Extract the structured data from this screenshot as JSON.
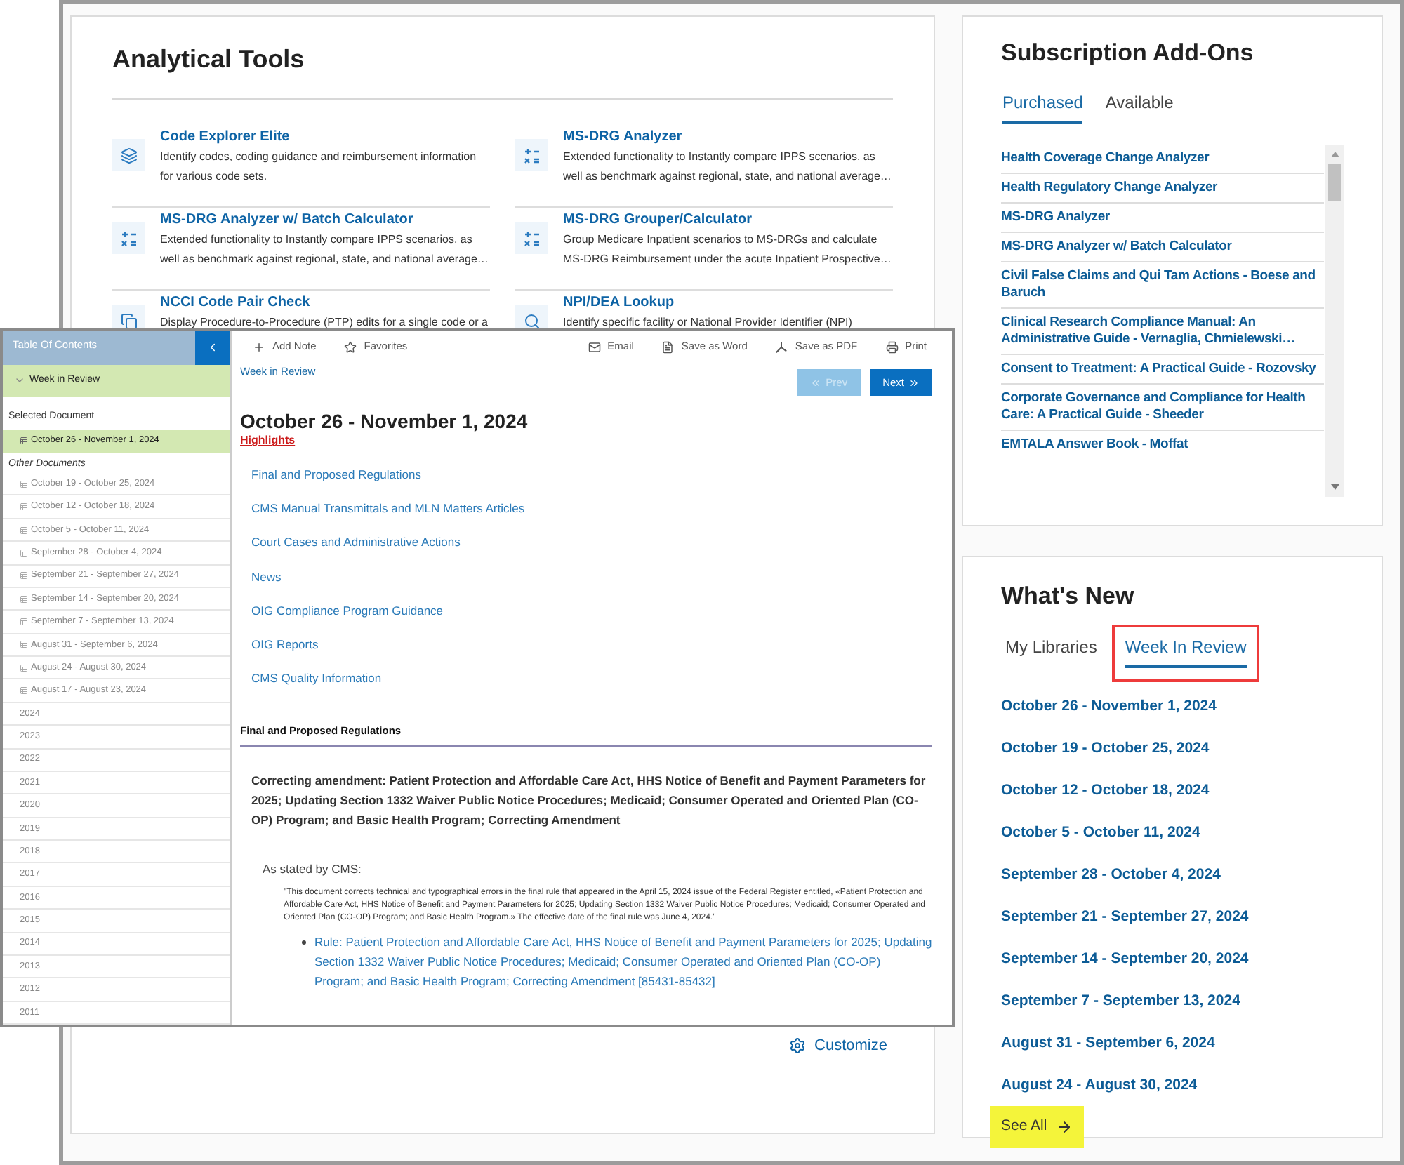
{
  "analytical_tools": {
    "title": "Analytical Tools",
    "tools": [
      {
        "kind": "explorer",
        "name": "Code Explorer Elite",
        "description": "Identify codes, coding guidance and reimbursement information for various code sets."
      },
      {
        "kind": "analyzer",
        "name": "MS-DRG Analyzer",
        "description": "Extended functionality to Instantly compare IPPS scenarios, as well as benchmark against regional, state, and national average…"
      },
      {
        "kind": "analyzer",
        "name": "MS-DRG Analyzer w/ Batch Calculator",
        "description": "Extended functionality to Instantly compare IPPS scenarios, as well as benchmark against regional, state, and national average…"
      },
      {
        "kind": "analyzer",
        "name": "MS-DRG Grouper/Calculator",
        "description": "Group Medicare Inpatient scenarios to MS-DRGs and calculate MS-DRG Reimbursement under the acute Inpatient Prospective…"
      },
      {
        "kind": "pair_check",
        "name": "NCCI Code Pair Check",
        "description": "Display Procedure-to-Procedure (PTP) edits for a single code or a"
      },
      {
        "kind": "lookup",
        "name": "NPI/DEA Lookup",
        "description": "Identify specific facility or National Provider Identifier (NPI)"
      }
    ],
    "customize": "Customize"
  },
  "subscription_addons": {
    "title": "Subscription Add-Ons",
    "tabs": [
      {
        "label": "Purchased",
        "selected": true
      },
      {
        "label": "Available",
        "selected": false
      }
    ],
    "items": [
      "Health Coverage Change Analyzer",
      "Health Regulatory Change Analyzer",
      "MS-DRG Analyzer",
      "MS-DRG Analyzer w/ Batch Calculator",
      "Civil False Claims and Qui Tam Actions - Boese and Baruch",
      "Clinical Research Compliance Manual: An Administrative Guide - Vernaglia, Chmielewski…",
      "Consent to Treatment: A Practical Guide - Rozovsky",
      "Corporate Governance and Compliance for Health Care: A Practical Guide - Sheeder",
      "EMTALA Answer Book - Moffat"
    ]
  },
  "whats_new": {
    "title": "What's New",
    "tabs": [
      {
        "label": "My Libraries",
        "selected": false,
        "annotated": false
      },
      {
        "label": "Week In Review",
        "selected": true,
        "annotated": true
      }
    ],
    "items": [
      "October 26 - November 1, 2024",
      "October 19 - October 25, 2024",
      "October 12 - October 18, 2024",
      "October 5 - October 11, 2024",
      "September 28 - October 4, 2024",
      "September 21 - September 27, 2024",
      "September 14 - September 20, 2024",
      "September 7 - September 13, 2024",
      "August 31 - September 6, 2024",
      "August 24 - August 30, 2024"
    ],
    "see_all": {
      "label": "See All",
      "highlighted": true
    }
  },
  "document_viewer": {
    "toc": {
      "title": "Table Of Contents",
      "section": {
        "label": "Week in Review",
        "expanded": true
      },
      "selected_heading": "Selected Document",
      "selected_document": "October 26 - November 1, 2024",
      "other_heading": "Other Documents",
      "documents": [
        "October 19 - October 25, 2024",
        "October 12 - October 18, 2024",
        "October 5 - October 11, 2024",
        "September 28 - October 4, 2024",
        "September 21 - September 27, 2024",
        "September 14 - September 20, 2024",
        "September 7 - September 13, 2024",
        "August 31 - September 6, 2024",
        "August 24 - August 30, 2024",
        "August 17 - August 23, 2024"
      ],
      "years": [
        "2024",
        "2023",
        "2022",
        "2021",
        "2020",
        "2019",
        "2018",
        "2017",
        "2016",
        "2015",
        "2014",
        "2013",
        "2012",
        "2011"
      ]
    },
    "toolbar_left": [
      {
        "kind": "add_note",
        "label": "Add Note"
      },
      {
        "kind": "favorites",
        "label": "Favorites"
      }
    ],
    "toolbar_right": [
      {
        "kind": "email",
        "label": "Email"
      },
      {
        "kind": "word",
        "label": "Save as Word"
      },
      {
        "kind": "pdf",
        "label": "Save as PDF"
      },
      {
        "kind": "print",
        "label": "Print"
      }
    ],
    "breadcrumb": "Week in Review",
    "prev": {
      "label": "Prev",
      "disabled": true
    },
    "next": {
      "label": "Next",
      "disabled": false
    },
    "heading": "October 26 - November 1, 2024",
    "highlights_label": "Highlights",
    "highlights": [
      "Final and Proposed Regulations",
      "CMS Manual Transmittals and MLN Matters Articles",
      "Court Cases and Administrative Actions",
      "News",
      "OIG Compliance Program Guidance",
      "OIG Reports",
      "CMS Quality Information"
    ],
    "section_title": "Final and Proposed Regulations",
    "article_title": "Correcting amendment: Patient Protection and Affordable Care Act, HHS Notice of Benefit and Payment Parameters for 2025; Updating Section 1332 Waiver Public Notice Procedures; Medicaid; Consumer Operated and Oriented Plan (CO-OP) Program; and Basic Health Program; Correcting Amendment",
    "stated_by": "As stated by CMS:",
    "quote": "\"This document corrects technical and typographical errors in the final rule that appeared in the April 15, 2024 issue of the Federal Register entitled, «Patient Protection and Affordable Care Act, HHS Notice of Benefit and Payment Parameters for 2025; Updating Section 1332 Waiver Public Notice Procedures; Medicaid; Consumer Operated and Oriented Plan (CO-OP) Program; and Basic Health Program.» The effective date of the final rule was June 4, 2024.\"",
    "rule_link": "Rule: Patient Protection and Affordable Care Act, HHS Notice of Benefit and Payment Parameters for 2025; Updating Section 1332 Waiver Public Notice Procedures; Medicaid; Consumer Operated and Oriented Plan (CO-OP) Program; and Basic Health Program; Correcting Amendment [85431-85432]"
  }
}
